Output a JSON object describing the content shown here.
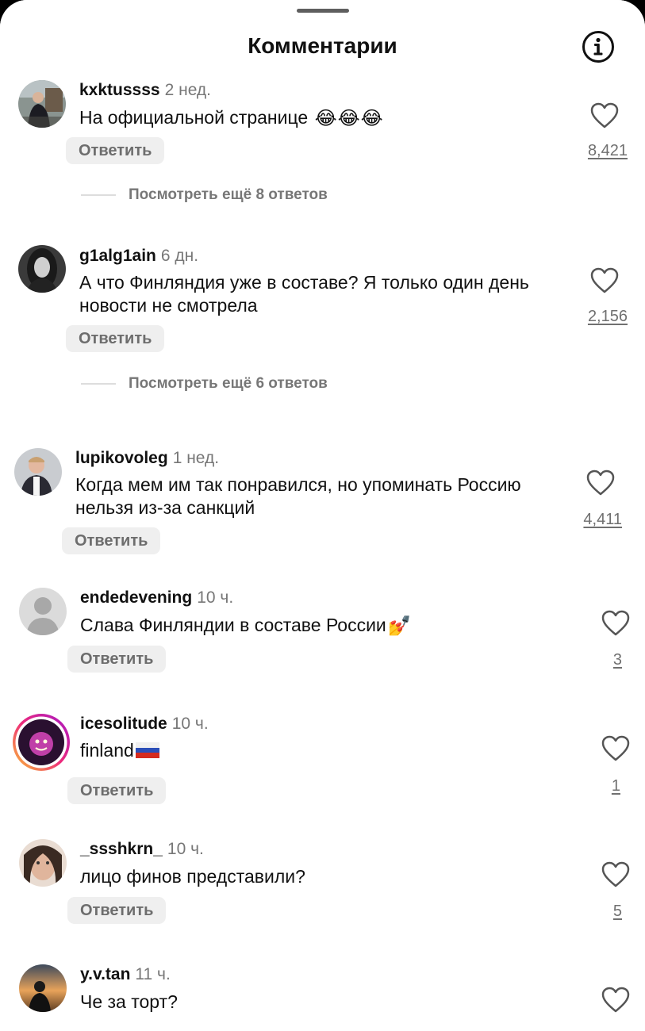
{
  "header": {
    "title": "Комментарии",
    "info_icon": "info-icon"
  },
  "comments": [
    {
      "username": "kxktussss",
      "time": "2 нед.",
      "text": "На официальной странице",
      "emoji": "😂😂😂",
      "reply_label": "Ответить",
      "likes": "8,421",
      "more_replies": "Посмотреть ещё 8 ответов"
    },
    {
      "username": "g1alg1ain",
      "time": "6 дн.",
      "text": "А что Финляндия уже в составе? Я только один день новости не смотрела",
      "reply_label": "Ответить",
      "likes": "2,156",
      "more_replies": "Посмотреть ещё 6 ответов"
    },
    {
      "username": "lupikovoleg",
      "time": "1 нед.",
      "text": "Когда мем им так понравился, но упоминать Россию нельзя из-за санкций",
      "reply_label": "Ответить",
      "likes": "4,411"
    },
    {
      "username": "endedevening",
      "time": "10 ч.",
      "text": "Слава Финляндии в составе России",
      "emoji": "💅",
      "reply_label": "Ответить",
      "likes": "3"
    },
    {
      "username": "icesolitude",
      "time": "10 ч.",
      "text": "finland",
      "emoji": "🇷🇺",
      "reply_label": "Ответить",
      "likes": "1"
    },
    {
      "username": "_ssshkrn_",
      "time": "10 ч.",
      "text": "лицо финов представили?",
      "reply_label": "Ответить",
      "likes": "5"
    },
    {
      "username": "y.v.tan",
      "time": "11 ч.",
      "text": "Че за торт?"
    }
  ]
}
